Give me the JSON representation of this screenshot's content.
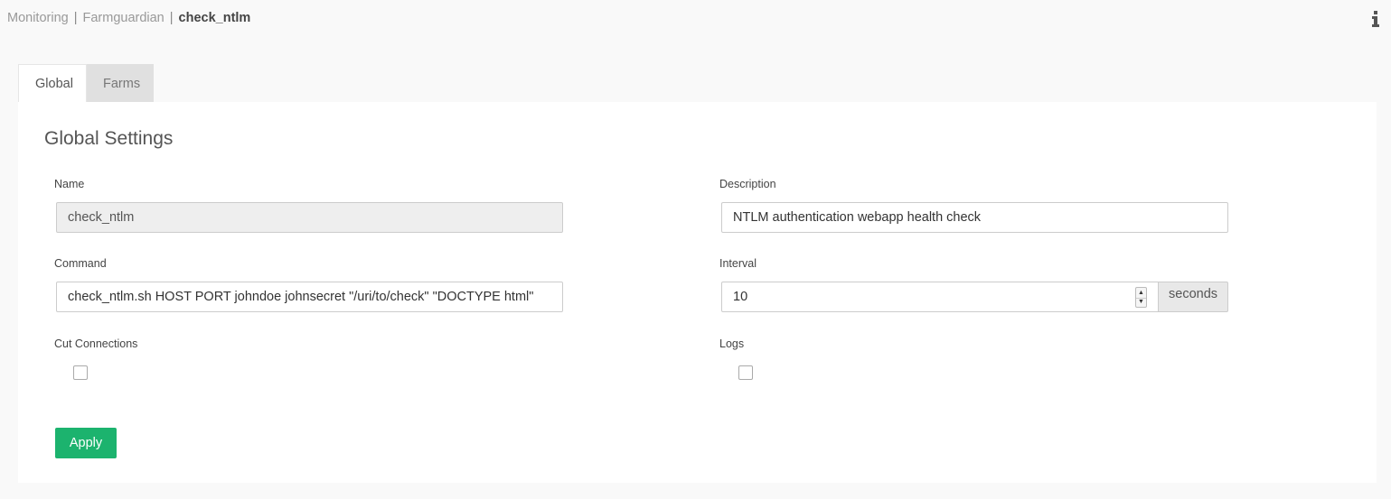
{
  "breadcrumb": {
    "items": [
      "Monitoring",
      "Farmguardian",
      "check_ntlm"
    ],
    "separator": "|"
  },
  "header": {
    "info_icon": "info-icon"
  },
  "tabs": [
    {
      "label": "Global",
      "active": true
    },
    {
      "label": "Farms",
      "active": false
    }
  ],
  "panel": {
    "title": "Global Settings",
    "name": {
      "label": "Name",
      "value": "check_ntlm"
    },
    "description": {
      "label": "Description",
      "value": "NTLM authentication webapp health check"
    },
    "command": {
      "label": "Command",
      "value": "check_ntlm.sh HOST PORT johndoe johnsecret \"/uri/to/check\" \"DOCTYPE html\""
    },
    "interval": {
      "label": "Interval",
      "value": "10",
      "unit": "seconds"
    },
    "cut_connections": {
      "label": "Cut Connections",
      "checked": false
    },
    "logs": {
      "label": "Logs",
      "checked": false
    },
    "apply_label": "Apply"
  },
  "colors": {
    "accent": "#1cb36e",
    "background": "#f9f9f9",
    "panel": "#ffffff",
    "readonly_field": "#eeeeee",
    "inactive_tab": "#e0e0e0"
  }
}
